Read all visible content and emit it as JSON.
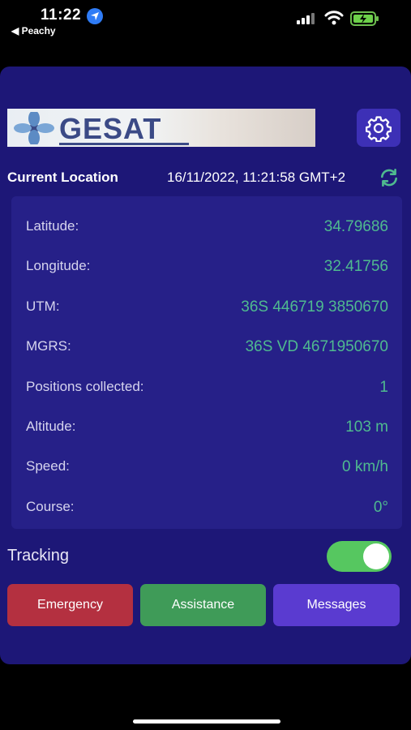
{
  "status_bar": {
    "time": "11:22",
    "back_app": "◀ Peachy"
  },
  "logo": {
    "text": "GESAT"
  },
  "location": {
    "title": "Current Location",
    "timestamp": "16/11/2022, 11:21:58 GMT+2"
  },
  "info": [
    {
      "label": "Latitude:",
      "value": "34.79686"
    },
    {
      "label": "Longitude:",
      "value": "32.41756"
    },
    {
      "label": "UTM:",
      "value": "36S 446719 3850670"
    },
    {
      "label": "MGRS:",
      "value": "36S VD 4671950670"
    },
    {
      "label": "Positions collected:",
      "value": "1"
    },
    {
      "label": "Altitude:",
      "value": "103 m"
    },
    {
      "label": "Speed:",
      "value": "0 km/h"
    },
    {
      "label": "Course:",
      "value": "0°"
    }
  ],
  "tracking": {
    "label": "Tracking",
    "enabled": true
  },
  "buttons": {
    "emergency": "Emergency",
    "assistance": "Assistance",
    "messages": "Messages"
  },
  "colors": {
    "panel": "#1d1777",
    "card": "#262088",
    "value_text": "#4fba8f",
    "emergency": "#b43040",
    "assistance": "#3f9b58",
    "messages": "#5a3bd0",
    "toggle_on": "#56c760"
  },
  "icons": [
    "location-arrow-icon",
    "signal-icon",
    "wifi-icon",
    "battery-charging-icon",
    "gear-icon",
    "refresh-icon"
  ]
}
